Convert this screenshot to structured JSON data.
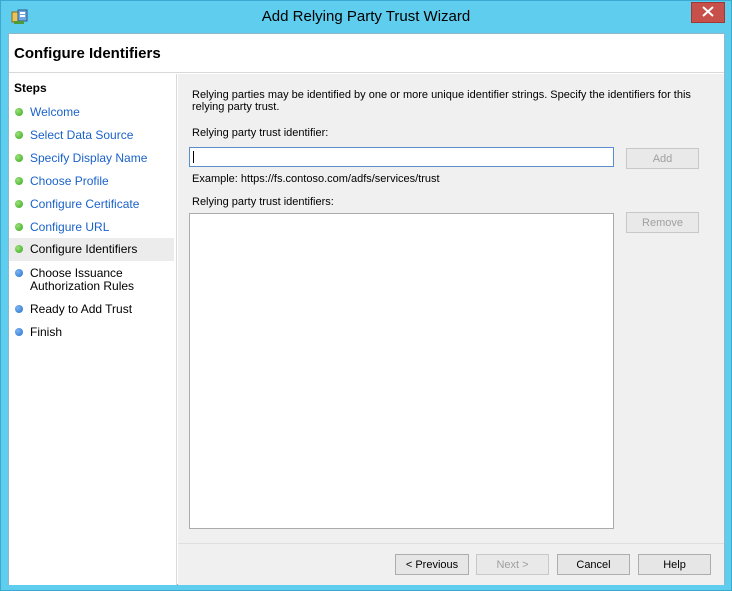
{
  "window": {
    "title": "Add Relying Party Trust Wizard",
    "colors": {
      "frame": "#5fcdee",
      "close": "#c7504a",
      "link": "#1a62c9"
    }
  },
  "header": {
    "title": "Configure Identifiers"
  },
  "steps": {
    "title": "Steps",
    "items": [
      {
        "label": "Welcome",
        "status": "done"
      },
      {
        "label": "Select Data Source",
        "status": "done"
      },
      {
        "label": "Specify Display Name",
        "status": "done"
      },
      {
        "label": "Choose Profile",
        "status": "done"
      },
      {
        "label": "Configure Certificate",
        "status": "done"
      },
      {
        "label": "Configure URL",
        "status": "done"
      },
      {
        "label": "Configure Identifiers",
        "status": "current"
      },
      {
        "label": "Choose Issuance\nAuthorization Rules",
        "status": "pending"
      },
      {
        "label": "Ready to Add Trust",
        "status": "pending"
      },
      {
        "label": "Finish",
        "status": "pending"
      }
    ]
  },
  "content": {
    "description": "Relying parties may be identified by one or more unique identifier strings. Specify the identifiers for this relying party trust.",
    "identifier_label": "Relying party trust identifier:",
    "identifier_value": "",
    "add_label": "Add",
    "example": "Example: https://fs.contoso.com/adfs/services/trust",
    "identifiers_label": "Relying party trust identifiers:",
    "identifiers": [],
    "remove_label": "Remove"
  },
  "footer": {
    "previous_label": "< Previous",
    "next_label": "Next >",
    "cancel_label": "Cancel",
    "help_label": "Help"
  }
}
